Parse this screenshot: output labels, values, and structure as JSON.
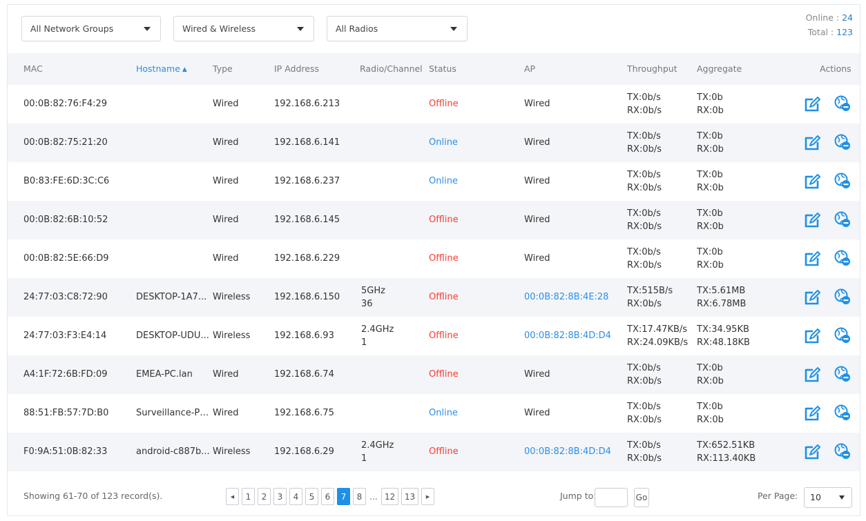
{
  "filters": {
    "group": "All Network Groups",
    "type": "Wired & Wireless",
    "radio": "All Radios"
  },
  "counts": {
    "online_label": "Online :",
    "online_value": "24",
    "total_label": "Total :",
    "total_value": "123"
  },
  "columns": {
    "mac": "MAC",
    "hostname": "Hostname",
    "type": "Type",
    "ip": "IP Address",
    "radio": "Radio/Channel",
    "status": "Status",
    "ap": "AP",
    "throughput": "Throughput",
    "aggregate": "Aggregate",
    "actions": "Actions"
  },
  "sort_arrow": "▲",
  "rows": [
    {
      "mac": "00:0B:82:76:F4:29",
      "host": "",
      "type": "Wired",
      "ip": "192.168.6.213",
      "band": "",
      "channel": "",
      "status": "Offline",
      "ap": "Wired",
      "tx": "TX:0b/s",
      "rx": "RX:0b/s",
      "agg_tx": "TX:0b",
      "agg_rx": "RX:0b"
    },
    {
      "mac": "00:0B:82:75:21:20",
      "host": "",
      "type": "Wired",
      "ip": "192.168.6.141",
      "band": "",
      "channel": "",
      "status": "Online",
      "ap": "Wired",
      "tx": "TX:0b/s",
      "rx": "RX:0b/s",
      "agg_tx": "TX:0b",
      "agg_rx": "RX:0b"
    },
    {
      "mac": "B0:83:FE:6D:3C:C6",
      "host": "",
      "type": "Wired",
      "ip": "192.168.6.237",
      "band": "",
      "channel": "",
      "status": "Online",
      "ap": "Wired",
      "tx": "TX:0b/s",
      "rx": "RX:0b/s",
      "agg_tx": "TX:0b",
      "agg_rx": "RX:0b"
    },
    {
      "mac": "00:0B:82:6B:10:52",
      "host": "",
      "type": "Wired",
      "ip": "192.168.6.145",
      "band": "",
      "channel": "",
      "status": "Offline",
      "ap": "Wired",
      "tx": "TX:0b/s",
      "rx": "RX:0b/s",
      "agg_tx": "TX:0b",
      "agg_rx": "RX:0b"
    },
    {
      "mac": "00:0B:82:5E:66:D9",
      "host": "",
      "type": "Wired",
      "ip": "192.168.6.229",
      "band": "",
      "channel": "",
      "status": "Offline",
      "ap": "Wired",
      "tx": "TX:0b/s",
      "rx": "RX:0b/s",
      "agg_tx": "TX:0b",
      "agg_rx": "RX:0b"
    },
    {
      "mac": "24:77:03:C8:72:90",
      "host": "DESKTOP-1A7...",
      "type": "Wireless",
      "ip": "192.168.6.150",
      "band": "5GHz",
      "channel": "36",
      "status": "Offline",
      "ap": "00:0B:82:8B:4E:28",
      "tx": "TX:515B/s",
      "rx": "RX:0b/s",
      "agg_tx": "TX:5.61MB",
      "agg_rx": "RX:6.78MB"
    },
    {
      "mac": "24:77:03:F3:E4:14",
      "host": "DESKTOP-UDU...",
      "type": "Wireless",
      "ip": "192.168.6.93",
      "band": "2.4GHz",
      "channel": "1",
      "status": "Offline",
      "ap": "00:0B:82:8B:4D:D4",
      "tx": "TX:17.47KB/s",
      "rx": "RX:24.09KB/s",
      "agg_tx": "TX:34.95KB",
      "agg_rx": "RX:48.18KB"
    },
    {
      "mac": "A4:1F:72:6B:FD:09",
      "host": "EMEA-PC.lan",
      "type": "Wired",
      "ip": "192.168.6.74",
      "band": "",
      "channel": "",
      "status": "Offline",
      "ap": "Wired",
      "tx": "TX:0b/s",
      "rx": "RX:0b/s",
      "agg_tx": "TX:0b",
      "agg_rx": "RX:0b"
    },
    {
      "mac": "88:51:FB:57:7D:B0",
      "host": "Surveillance-PC...",
      "type": "Wired",
      "ip": "192.168.6.75",
      "band": "",
      "channel": "",
      "status": "Online",
      "ap": "Wired",
      "tx": "TX:0b/s",
      "rx": "RX:0b/s",
      "agg_tx": "TX:0b",
      "agg_rx": "RX:0b"
    },
    {
      "mac": "F0:9A:51:0B:82:33",
      "host": "android-c887b...",
      "type": "Wireless",
      "ip": "192.168.6.29",
      "band": "2.4GHz",
      "channel": "1",
      "status": "Offline",
      "ap": "00:0B:82:8B:4D:D4",
      "tx": "TX:0b/s",
      "rx": "RX:0b/s",
      "agg_tx": "TX:652.51KB",
      "agg_rx": "RX:113.40KB"
    }
  ],
  "footer": {
    "showing": "Showing 61-70 of 123 record(s).",
    "pages": [
      "1",
      "2",
      "3",
      "4",
      "5",
      "6",
      "7",
      "8"
    ],
    "current_page": "7",
    "ellipsis": "...",
    "last_pages": [
      "12",
      "13"
    ],
    "prev_icon": "◀",
    "next_icon": "▶",
    "jump_label": "Jump to:",
    "jump_value": "",
    "go_label": "Go",
    "per_page_label": "Per Page:",
    "per_page_value": "10"
  },
  "icons": {
    "edit": "edit-icon",
    "block": "block-client-icon"
  },
  "colors": {
    "online": "#2b8ee8",
    "offline": "#ff3b30",
    "active_page": "#1e90e6",
    "header_bg": "#f3f5f8"
  }
}
